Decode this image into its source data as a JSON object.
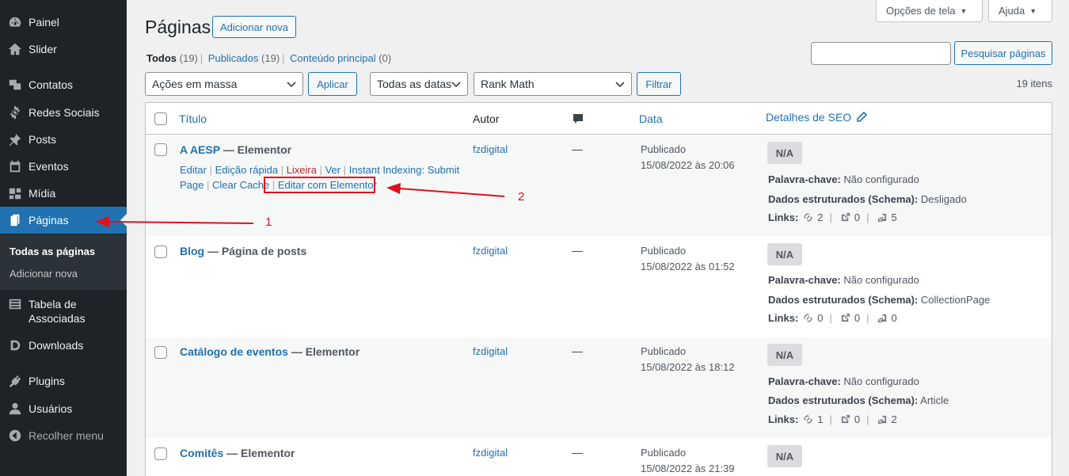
{
  "sidebar": {
    "items": [
      {
        "label": "Painel",
        "icon": "dashboard-icon"
      },
      {
        "label": "Slider",
        "icon": "home-icon"
      },
      {
        "label": "Contatos",
        "icon": "contacts-icon"
      },
      {
        "label": "Redes Sociais",
        "icon": "gear-icon"
      },
      {
        "label": "Posts",
        "icon": "pin-icon"
      },
      {
        "label": "Eventos",
        "icon": "calendar-icon"
      },
      {
        "label": "Mídia",
        "icon": "media-icon"
      },
      {
        "label": "Páginas",
        "icon": "pages-icon"
      },
      {
        "label": "Tabela de Associadas",
        "icon": "table-icon"
      },
      {
        "label": "Downloads",
        "icon": "downloads-icon"
      },
      {
        "label": "Plugins",
        "icon": "plugin-icon"
      },
      {
        "label": "Usuários",
        "icon": "user-icon"
      },
      {
        "label": "Recolher menu",
        "icon": "collapse-icon"
      }
    ],
    "submenu": [
      "Todas as páginas",
      "Adicionar nova"
    ]
  },
  "header": {
    "screen_options": "Opções de tela",
    "help": "Ajuda",
    "title": "Páginas",
    "add_new": "Adicionar nova"
  },
  "filters": {
    "views": [
      {
        "label": "Todos",
        "count": "(19)"
      },
      {
        "label": "Publicados",
        "count": "(19)"
      },
      {
        "label": "Conteúdo principal",
        "count": "(0)"
      }
    ],
    "search_button": "Pesquisar páginas",
    "bulk_actions": "Ações em massa",
    "apply": "Aplicar",
    "dates": "Todas as datas",
    "seo_filter": "Rank Math",
    "filter": "Filtrar",
    "items_count": "19 itens"
  },
  "table": {
    "columns": {
      "title": "Título",
      "author": "Autor",
      "date": "Data",
      "seo": "Detalhes de SEO"
    },
    "row_actions": {
      "edit": "Editar",
      "quick_edit": "Edição rápida",
      "trash": "Lixeira",
      "view": "Ver",
      "instant_indexing": "Instant Indexing: Submit Page",
      "clear_cache": "Clear Cache",
      "elementor": "Editar com Elementor"
    },
    "rows": [
      {
        "title": "A AESP",
        "state": "— Elementor",
        "author": "fzdigital",
        "comments": "—",
        "status": "Publicado",
        "date": "15/08/2022 às 20:06",
        "seo_score": "N/A",
        "keyword_label": "Palavra-chave:",
        "keyword": "Não configurado",
        "schema_label": "Dados estruturados (Schema):",
        "schema": "Desligado",
        "links_label": "Links:",
        "internal": "2",
        "external": "0",
        "incoming": "5"
      },
      {
        "title": "Blog",
        "state": "— Página de posts",
        "author": "fzdigital",
        "comments": "—",
        "status": "Publicado",
        "date": "15/08/2022 às 01:52",
        "seo_score": "N/A",
        "keyword_label": "Palavra-chave:",
        "keyword": "Não configurado",
        "schema_label": "Dados estruturados (Schema):",
        "schema": "CollectionPage",
        "links_label": "Links:",
        "internal": "0",
        "external": "0",
        "incoming": "0"
      },
      {
        "title": "Catálogo de eventos",
        "state": "— Elementor",
        "author": "fzdigital",
        "comments": "—",
        "status": "Publicado",
        "date": "15/08/2022 às 18:12",
        "seo_score": "N/A",
        "keyword_label": "Palavra-chave:",
        "keyword": "Não configurado",
        "schema_label": "Dados estruturados (Schema):",
        "schema": "Article",
        "links_label": "Links:",
        "internal": "1",
        "external": "0",
        "incoming": "2"
      },
      {
        "title": "Comitês",
        "state": "— Elementor",
        "author": "fzdigital",
        "comments": "—",
        "status": "Publicado",
        "date": "15/08/2022 às 21:39",
        "seo_score": "N/A"
      }
    ]
  },
  "annotations": {
    "one": "1",
    "two": "2"
  },
  "colors": {
    "accent": "#2271b1",
    "sidebar": "#1d2327",
    "annotation": "#e0111b"
  }
}
